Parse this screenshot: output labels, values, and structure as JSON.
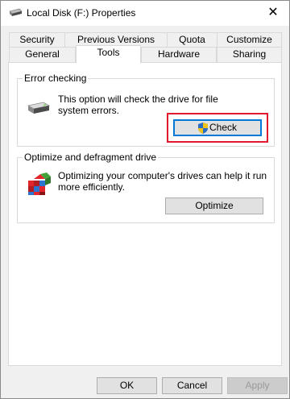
{
  "window": {
    "title": "Local Disk (F:) Properties",
    "close_glyph": "✕"
  },
  "tabs": {
    "row1": [
      "Security",
      "Previous Versions",
      "Quota",
      "Customize"
    ],
    "row2": [
      "General",
      "Tools",
      "Hardware",
      "Sharing"
    ],
    "active": "Tools"
  },
  "error_checking": {
    "title": "Error checking",
    "description_line1": "This option will check the drive for file",
    "description_line2": "system errors.",
    "check_label": "Check",
    "icon": "drive-icon",
    "button_icon": "uac-shield-icon"
  },
  "optimize": {
    "title": "Optimize and defragment drive",
    "description_line1": "Optimizing your computer's drives can help it run",
    "description_line2": "more efficiently.",
    "optimize_label": "Optimize",
    "icon": "defrag-icon"
  },
  "footer": {
    "ok_label": "OK",
    "cancel_label": "Cancel",
    "apply_label": "Apply"
  },
  "colors": {
    "highlight": "#e0192c",
    "focus": "#0078d7"
  }
}
